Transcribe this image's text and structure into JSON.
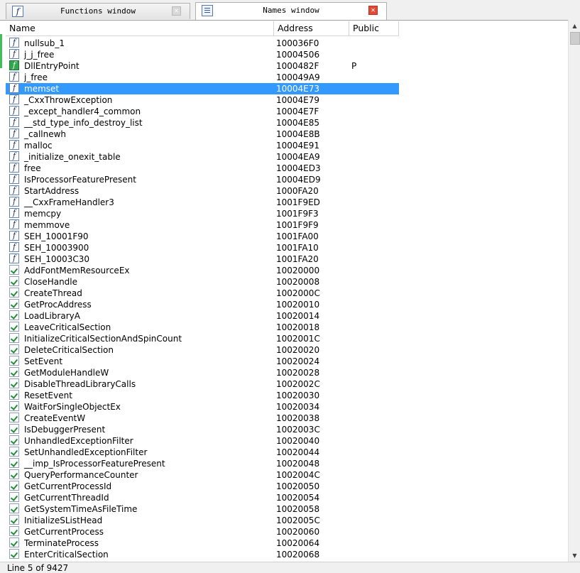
{
  "tabs": [
    {
      "label": "Functions window",
      "icon": "function-icon",
      "active": false
    },
    {
      "label": "Names window",
      "icon": "window-icon",
      "active": true
    }
  ],
  "columns": {
    "name": "Name",
    "address": "Address",
    "public": "Public"
  },
  "rows": [
    {
      "icon": "function",
      "name": "nullsub_1",
      "address": "100036F0",
      "public": ""
    },
    {
      "icon": "function",
      "name": "j_j_free",
      "address": "10004506",
      "public": ""
    },
    {
      "icon": "entry",
      "name": "DllEntryPoint",
      "address": "1000482F",
      "public": "P"
    },
    {
      "icon": "function",
      "name": "j_free",
      "address": "100049A9",
      "public": ""
    },
    {
      "icon": "function",
      "name": "memset",
      "address": "10004E73",
      "public": "",
      "selected": true
    },
    {
      "icon": "function",
      "name": "_CxxThrowException",
      "address": "10004E79",
      "public": ""
    },
    {
      "icon": "function",
      "name": "_except_handler4_common",
      "address": "10004E7F",
      "public": ""
    },
    {
      "icon": "function",
      "name": "__std_type_info_destroy_list",
      "address": "10004E85",
      "public": ""
    },
    {
      "icon": "function",
      "name": "_callnewh",
      "address": "10004E8B",
      "public": ""
    },
    {
      "icon": "function",
      "name": "malloc",
      "address": "10004E91",
      "public": ""
    },
    {
      "icon": "function",
      "name": "_initialize_onexit_table",
      "address": "10004EA9",
      "public": ""
    },
    {
      "icon": "function",
      "name": "free",
      "address": "10004ED3",
      "public": ""
    },
    {
      "icon": "function",
      "name": "IsProcessorFeaturePresent",
      "address": "10004ED9",
      "public": ""
    },
    {
      "icon": "function",
      "name": "StartAddress",
      "address": "1000FA20",
      "public": ""
    },
    {
      "icon": "function",
      "name": "__CxxFrameHandler3",
      "address": "1001F9ED",
      "public": ""
    },
    {
      "icon": "function",
      "name": "memcpy",
      "address": "1001F9F3",
      "public": ""
    },
    {
      "icon": "function",
      "name": "memmove",
      "address": "1001F9F9",
      "public": ""
    },
    {
      "icon": "function",
      "name": "SEH_10001F90",
      "address": "1001FA00",
      "public": ""
    },
    {
      "icon": "function",
      "name": "SEH_10003900",
      "address": "1001FA10",
      "public": ""
    },
    {
      "icon": "function",
      "name": "SEH_10003C30",
      "address": "1001FA20",
      "public": ""
    },
    {
      "icon": "import",
      "name": "AddFontMemResourceEx",
      "address": "10020000",
      "public": ""
    },
    {
      "icon": "import",
      "name": "CloseHandle",
      "address": "10020008",
      "public": ""
    },
    {
      "icon": "import",
      "name": "CreateThread",
      "address": "1002000C",
      "public": ""
    },
    {
      "icon": "import",
      "name": "GetProcAddress",
      "address": "10020010",
      "public": ""
    },
    {
      "icon": "import",
      "name": "LoadLibraryA",
      "address": "10020014",
      "public": ""
    },
    {
      "icon": "import",
      "name": "LeaveCriticalSection",
      "address": "10020018",
      "public": ""
    },
    {
      "icon": "import",
      "name": "InitializeCriticalSectionAndSpinCount",
      "address": "1002001C",
      "public": ""
    },
    {
      "icon": "import",
      "name": "DeleteCriticalSection",
      "address": "10020020",
      "public": ""
    },
    {
      "icon": "import",
      "name": "SetEvent",
      "address": "10020024",
      "public": ""
    },
    {
      "icon": "import",
      "name": "GetModuleHandleW",
      "address": "10020028",
      "public": ""
    },
    {
      "icon": "import",
      "name": "DisableThreadLibraryCalls",
      "address": "1002002C",
      "public": ""
    },
    {
      "icon": "import",
      "name": "ResetEvent",
      "address": "10020030",
      "public": ""
    },
    {
      "icon": "import",
      "name": "WaitForSingleObjectEx",
      "address": "10020034",
      "public": ""
    },
    {
      "icon": "import",
      "name": "CreateEventW",
      "address": "10020038",
      "public": ""
    },
    {
      "icon": "import",
      "name": "IsDebuggerPresent",
      "address": "1002003C",
      "public": ""
    },
    {
      "icon": "import",
      "name": "UnhandledExceptionFilter",
      "address": "10020040",
      "public": ""
    },
    {
      "icon": "import",
      "name": "SetUnhandledExceptionFilter",
      "address": "10020044",
      "public": ""
    },
    {
      "icon": "import",
      "name": "__imp_IsProcessorFeaturePresent",
      "address": "10020048",
      "public": ""
    },
    {
      "icon": "import",
      "name": "QueryPerformanceCounter",
      "address": "1002004C",
      "public": ""
    },
    {
      "icon": "import",
      "name": "GetCurrentProcessId",
      "address": "10020050",
      "public": ""
    },
    {
      "icon": "import",
      "name": "GetCurrentThreadId",
      "address": "10020054",
      "public": ""
    },
    {
      "icon": "import",
      "name": "GetSystemTimeAsFileTime",
      "address": "10020058",
      "public": ""
    },
    {
      "icon": "import",
      "name": "InitializeSListHead",
      "address": "1002005C",
      "public": ""
    },
    {
      "icon": "import",
      "name": "GetCurrentProcess",
      "address": "10020060",
      "public": ""
    },
    {
      "icon": "import",
      "name": "TerminateProcess",
      "address": "10020064",
      "public": ""
    },
    {
      "icon": "import",
      "name": "EnterCriticalSection",
      "address": "10020068",
      "public": ""
    }
  ],
  "status": {
    "text": "Line 5 of 9427"
  },
  "colors": {
    "selection": "#3399ff",
    "entry_point": "#2fa84f",
    "gutter": "#3fbf5a",
    "tab_close_active": "#e04a3a"
  }
}
